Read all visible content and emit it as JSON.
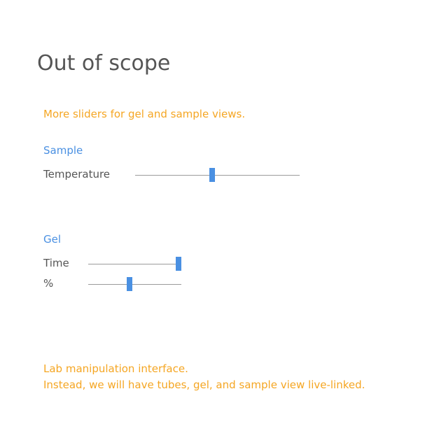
{
  "title": "Out of scope",
  "intro_note": "More sliders for gel and sample views.",
  "sample": {
    "heading": "Sample",
    "sliders": [
      {
        "label": "Temperature",
        "value": 0.47
      }
    ]
  },
  "gel": {
    "heading": "Gel",
    "sliders": [
      {
        "label": "Time",
        "value": 0.97
      },
      {
        "label": "%",
        "value": 0.44
      }
    ]
  },
  "footer_note": {
    "line1": "Lab manipulation interface.",
    "line2": "Instead, we will have tubes, gel, and sample view  live-linked."
  },
  "colors": {
    "accent_orange": "#f5a623",
    "accent_blue": "#4a90e2",
    "text_gray": "#555555",
    "track_gray": "#9b9b9b"
  }
}
